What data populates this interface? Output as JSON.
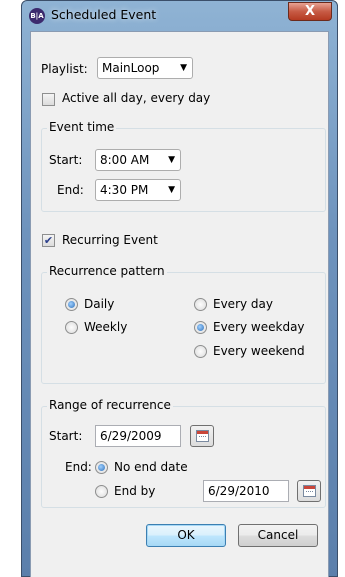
{
  "window": {
    "title": "Scheduled Event",
    "app_icon_text": "B|A",
    "close_glyph": "X"
  },
  "playlist": {
    "label": "Playlist:",
    "selected": "MainLoop",
    "arrow": "▼"
  },
  "active_all_day": {
    "label": "Active all day, every day",
    "checked": false
  },
  "event_time": {
    "title": "Event time",
    "start_label": "Start:",
    "start_value": "8:00 AM",
    "end_label": "End:",
    "end_value": "4:30 PM",
    "arrow": "▼"
  },
  "recurring": {
    "label": "Recurring Event",
    "checked": true,
    "check_glyph": "✔"
  },
  "recurrence_pattern": {
    "title": "Recurrence pattern",
    "daily": "Daily",
    "weekly": "Weekly",
    "every_day": "Every day",
    "every_weekday": "Every weekday",
    "every_weekend": "Every weekend",
    "selected_frequency": "Daily",
    "selected_days": "Every weekday"
  },
  "range": {
    "title": "Range of recurrence",
    "start_label": "Start:",
    "start_value": "6/29/2009",
    "end_label": "End:",
    "no_end_date": "No end date",
    "end_by": "End by",
    "end_by_value": "6/29/2010",
    "selected": "No end date"
  },
  "buttons": {
    "ok": "OK",
    "cancel": "Cancel"
  }
}
